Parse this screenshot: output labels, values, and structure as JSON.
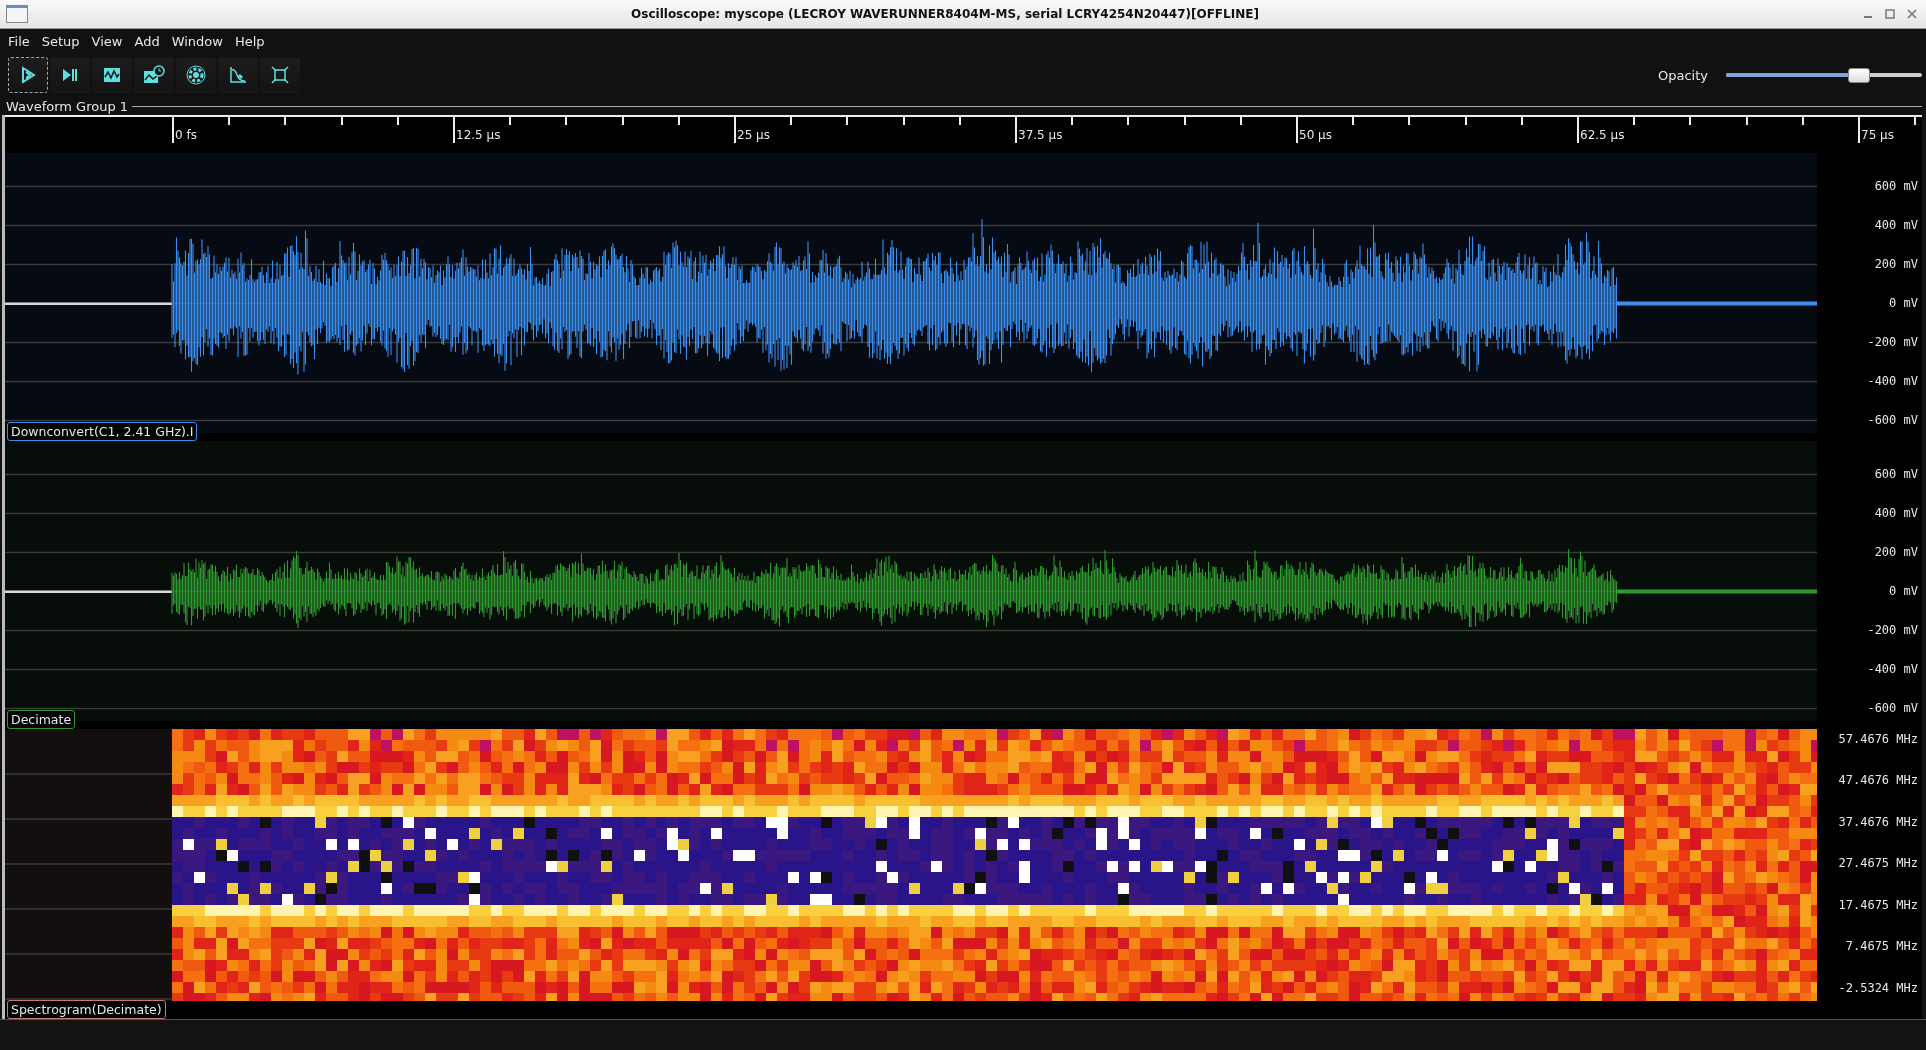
{
  "window": {
    "title": "Oscilloscope: myscope (LECROY WAVERUNNER8404M-MS, serial LCRY4254N20447)[OFFLINE]"
  },
  "menu": [
    "File",
    "Setup",
    "View",
    "Add",
    "Window",
    "Help"
  ],
  "toolbar": [
    {
      "kind": "play",
      "focused": true
    },
    {
      "kind": "step",
      "focused": false
    },
    {
      "kind": "waveform",
      "focused": false
    },
    {
      "kind": "history",
      "focused": false
    },
    {
      "kind": "gear",
      "focused": false
    },
    {
      "kind": "filter",
      "focused": false
    },
    {
      "kind": "fullscreen",
      "focused": false
    }
  ],
  "opacity": {
    "label": "Opacity",
    "level": 0.68
  },
  "group": {
    "title": "Waveform Group 1",
    "time_ticks": [
      "0 fs",
      "12.5 µs",
      "25 µs",
      "37.5 µs",
      "50 µs",
      "62.5 µs",
      "75 µs"
    ]
  },
  "plots": [
    {
      "kind": "waveform",
      "color": "#3a8ff0",
      "label": "Downconvert(C1, 2.41 GHz).I",
      "axis": [
        "600 mV",
        "400 mV",
        "200 mV",
        "0 mV",
        "-200 mV",
        "-400 mV",
        "-600 mV"
      ]
    },
    {
      "kind": "waveform",
      "color": "#2f9a2f",
      "label": "Decimate",
      "axis": [
        "600 mV",
        "400 mV",
        "200 mV",
        "0 mV",
        "-200 mV",
        "-400 mV",
        "-600 mV"
      ]
    },
    {
      "kind": "spectrogram",
      "color": "#c87878",
      "label": "Spectrogram(Decimate)",
      "axis": [
        "57.4676 MHz",
        "47.4676 MHz",
        "37.4676 MHz",
        "27.4675 MHz",
        "17.4675 MHz",
        "7.4675 MHz",
        "-2.5324 MHz"
      ]
    }
  ]
}
